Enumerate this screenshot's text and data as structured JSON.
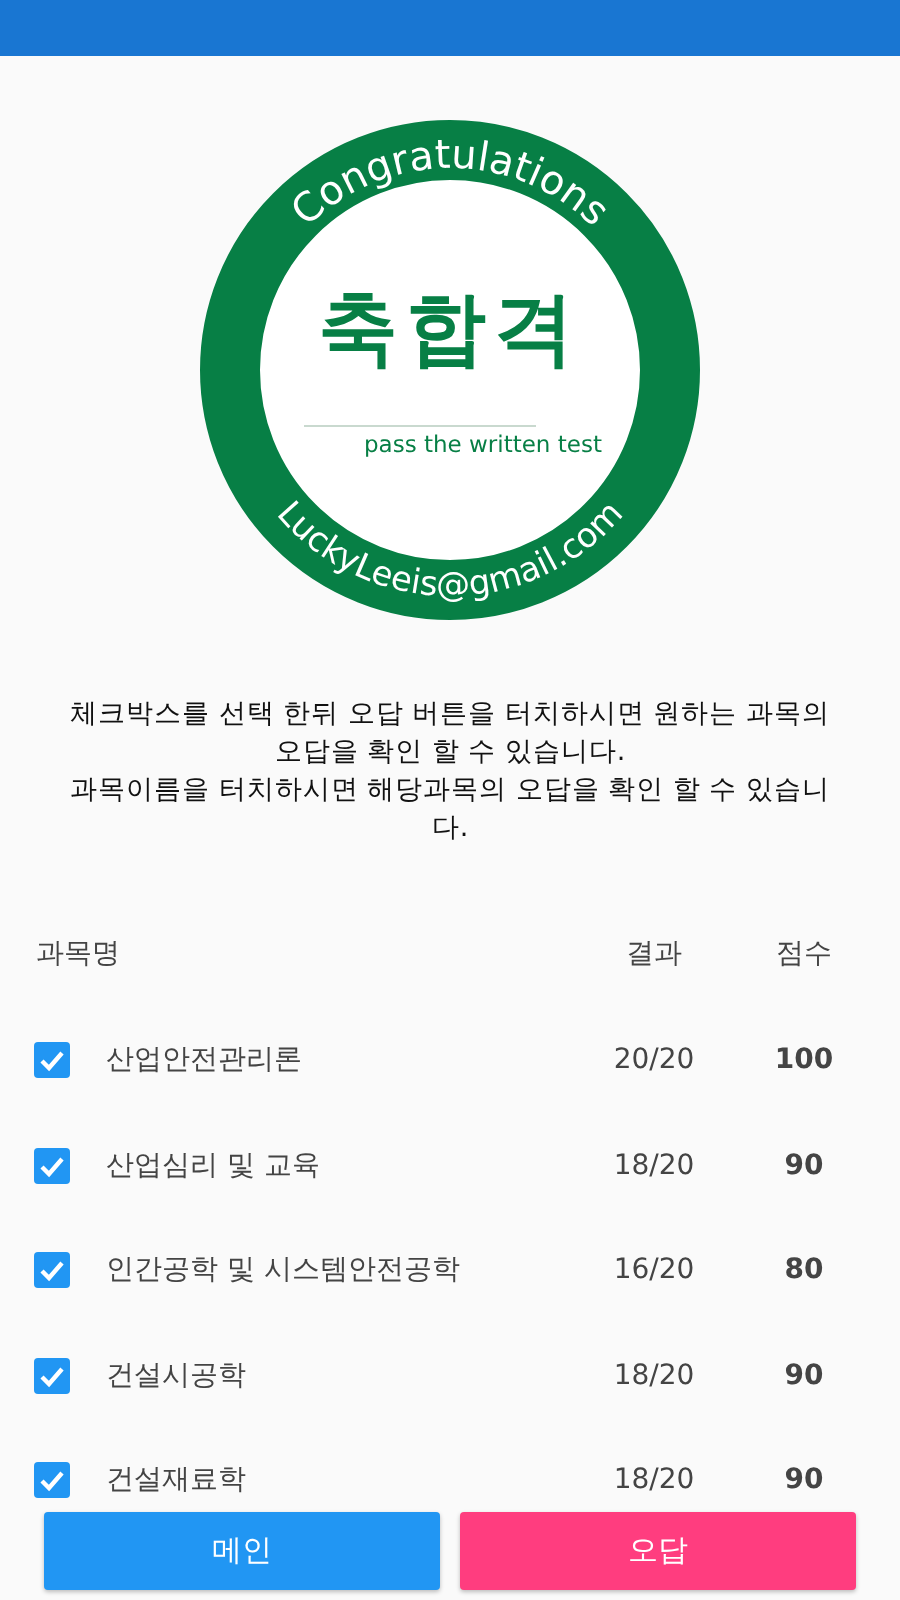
{
  "stamp": {
    "top_text": "Congratulations",
    "center_text": "축합격",
    "subtitle": "pass the written test",
    "bottom_text": "LuckyLeeis@gmail.com"
  },
  "instructions": [
    "체크박스를 선택 한뒤 오답 버튼을 터치하시면 원하는 과목의 오답을 확인 할 수 있습니다.",
    "과목이름을 터치하시면 해당과목의 오답을 확인 할 수 있습니다."
  ],
  "table": {
    "columns": [
      "과목명",
      "결과",
      "점수"
    ],
    "rows": [
      {
        "checked": true,
        "subject": "산업안전관리론",
        "result": "20/20",
        "score": "100"
      },
      {
        "checked": true,
        "subject": "산업심리 및 교육",
        "result": "18/20",
        "score": "90"
      },
      {
        "checked": true,
        "subject": "인간공학 및 시스템안전공학",
        "result": "16/20",
        "score": "80"
      },
      {
        "checked": true,
        "subject": "건설시공학",
        "result": "18/20",
        "score": "90"
      },
      {
        "checked": true,
        "subject": "건설재료학",
        "result": "18/20",
        "score": "90"
      }
    ]
  },
  "buttons": [
    {
      "label": "메인",
      "kind": "primary"
    },
    {
      "label": "오답",
      "kind": "accent"
    }
  ]
}
